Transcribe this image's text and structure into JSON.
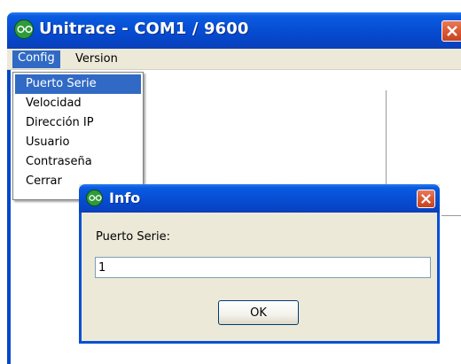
{
  "window": {
    "title": "Unitrace - COM1 / 9600",
    "icon": "app-glasses-icon",
    "close_icon": "close-icon"
  },
  "menubar": {
    "items": [
      "Config",
      "Version"
    ]
  },
  "config_menu": {
    "items": [
      "Puerto Serie",
      "Velocidad",
      "Dirección IP",
      "Usuario",
      "Contraseña",
      "Cerrar"
    ],
    "selected": "Puerto Serie"
  },
  "dialog": {
    "title": "Info",
    "label": "Puerto Serie:",
    "value": "1",
    "ok_label": "OK",
    "close_icon": "close-icon"
  },
  "colors": {
    "titlebar": "#0750d6",
    "selection": "#316ac5",
    "close": "#d95a32",
    "dialog_bg": "#ece9d8"
  }
}
